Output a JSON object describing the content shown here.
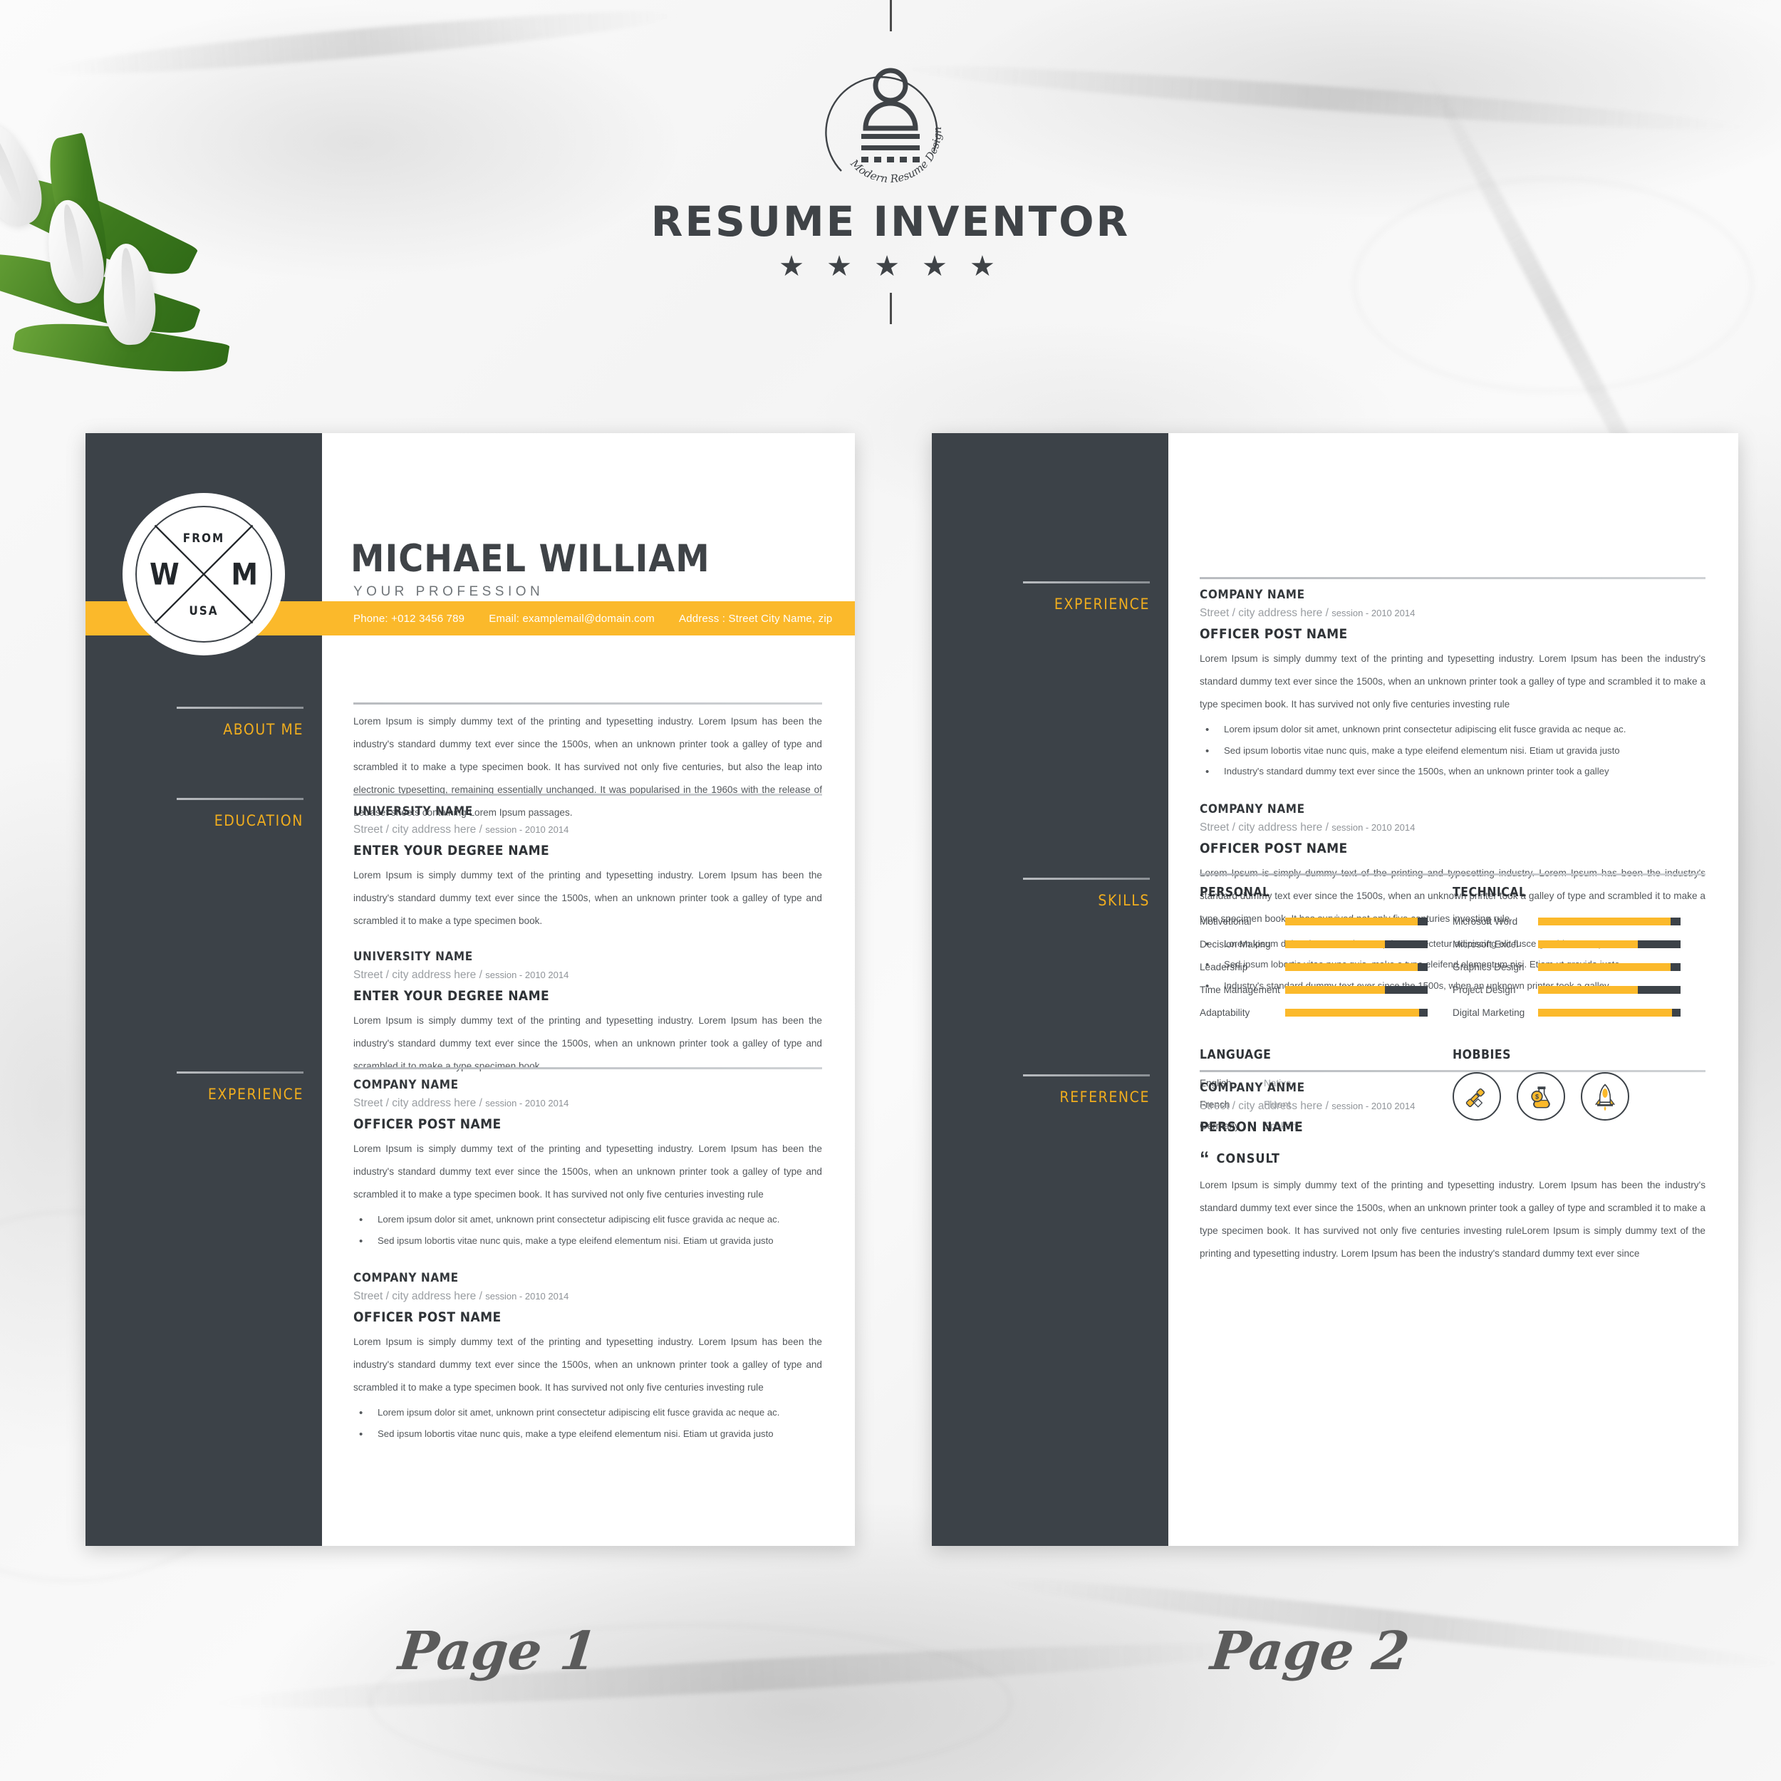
{
  "brand": {
    "title": "RESUME INVENTOR",
    "logo_caption": "Modern Resume Design",
    "stars": "★ ★ ★ ★ ★"
  },
  "page1": {
    "caption": "Page 1",
    "name": "MICHAEL WILLIAM",
    "profession": "YOUR PROFESSION",
    "monogram": {
      "top": "FROM",
      "left": "W",
      "right": "M",
      "bottom": "USA"
    },
    "contact": {
      "phone": "Phone: +012 3456 789",
      "email": "Email: examplemail@domain.com",
      "address": "Address : Street City Name, zip"
    },
    "rail": [
      {
        "label": "ABOUT ME"
      },
      {
        "label": "EDUCATION"
      },
      {
        "label": "EXPERIENCE"
      }
    ],
    "about": {
      "text": "Lorem Ipsum is simply dummy text of the printing and typesetting industry. Lorem Ipsum has been the industry's standard dummy text ever since the 1500s, when an unknown printer took a galley of type and scrambled it to make a type specimen book. It has survived not only five centuries, but also the leap into electronic typesetting, remaining essentially unchanged. It was popularised in the 1960s with the release of Letraset sheets containing Lorem Ipsum passages."
    },
    "education": [
      {
        "org": "UNIVERSITY NAME",
        "meta_main": "Street / city address here / ",
        "meta_sub": "session - 2010 2014",
        "role": "ENTER YOUR DEGREE NAME",
        "text": "Lorem Ipsum is simply dummy text of the printing and typesetting industry. Lorem Ipsum has been the industry's standard dummy text ever since the 1500s, when an unknown printer took a galley of type and scrambled it to make a type specimen book."
      },
      {
        "org": "UNIVERSITY NAME",
        "meta_main": "Street / city address here / ",
        "meta_sub": "session - 2010 2014",
        "role": "ENTER YOUR DEGREE NAME",
        "text": "Lorem Ipsum is simply dummy text of the printing and typesetting industry. Lorem Ipsum has been the industry's standard dummy text ever since the 1500s, when an unknown printer took a galley of type and scrambled it to make a type specimen book."
      }
    ],
    "experience": [
      {
        "org": "COMPANY NAME",
        "meta_main": "Street / city address here / ",
        "meta_sub": "session - 2010 2014",
        "role": "OFFICER POST NAME",
        "text": "Lorem Ipsum is simply dummy text of the printing and typesetting industry. Lorem Ipsum has been the industry's standard dummy text ever since the 1500s, when an unknown printer took a galley of type and scrambled it to make a type specimen book. It has survived not only five centuries investing rule",
        "bullets": [
          "Lorem ipsum dolor sit amet, unknown print consectetur adipiscing elit fusce gravida ac neque ac.",
          "Sed ipsum lobortis vitae nunc quis, make a type eleifend elementum nisi. Etiam ut gravida justo"
        ]
      },
      {
        "org": "COMPANY NAME",
        "meta_main": "Street / city address here / ",
        "meta_sub": "session - 2010 2014",
        "role": "OFFICER POST NAME",
        "text": "Lorem Ipsum is simply dummy text of the printing and typesetting industry. Lorem Ipsum has been the industry's standard dummy text ever since the 1500s, when an unknown printer took a galley of type and scrambled it to make a type specimen book. It has survived not only five centuries investing rule",
        "bullets": [
          "Lorem ipsum dolor sit amet, unknown print consectetur adipiscing elit fusce gravida ac neque ac.",
          "Sed ipsum lobortis vitae nunc quis, make a type eleifend elementum nisi. Etiam ut gravida justo"
        ]
      }
    ]
  },
  "page2": {
    "caption": "Page 2",
    "rail": [
      {
        "label": "EXPERIENCE"
      },
      {
        "label": "SKILLS"
      },
      {
        "label": "REFERENCE"
      }
    ],
    "experience": [
      {
        "org": "COMPANY NAME",
        "meta_main": "Street / city address here / ",
        "meta_sub": "session - 2010 2014",
        "role": "OFFICER POST NAME",
        "text": "Lorem Ipsum is simply dummy text of the printing and typesetting industry. Lorem Ipsum has been the industry's standard dummy text ever since the 1500s, when an unknown printer took a galley of type and scrambled it to make a type specimen book. It has survived not only five centuries investing rule",
        "bullets": [
          "Lorem ipsum dolor sit amet, unknown print consectetur adipiscing elit fusce gravida ac neque ac.",
          "Sed ipsum lobortis vitae nunc quis, make a type eleifend elementum nisi. Etiam ut gravida justo",
          "Industry's standard dummy text ever since the 1500s, when an unknown printer took a galley"
        ]
      },
      {
        "org": "COMPANY NAME",
        "meta_main": "Street / city address here / ",
        "meta_sub": "session - 2010 2014",
        "role": "OFFICER POST NAME",
        "text": "Lorem Ipsum is simply dummy text of the printing and typesetting industry. Lorem Ipsum has been the industry's standard dummy text ever since the 1500s, when an unknown printer took a galley of type and scrambled it to make a type specimen book. It has survived not only five centuries investing rule",
        "bullets": [
          "Lorem ipsum dolor sit amet, unknown print consectetur adipiscing elit fusce gravida ac neque ac.",
          "Sed ipsum lobortis vitae nunc quis, make a type eleifend elementum nisi. Etiam ut gravida justo",
          "Industry's standard dummy text ever since the 1500s, when an unknown printer took a galley"
        ]
      }
    ],
    "skills": {
      "personal_heading": "PERSONAL",
      "technical_heading": "TECHNICAL",
      "personal": [
        {
          "name": "Motivetional",
          "value": 93
        },
        {
          "name": "Decision Making",
          "value": 70
        },
        {
          "name": "Leadership",
          "value": 93
        },
        {
          "name": "Time Management",
          "value": 70
        },
        {
          "name": "Adaptability",
          "value": 94
        }
      ],
      "technical": [
        {
          "name": "Microsoft Word",
          "value": 93
        },
        {
          "name": "Microsoft Excel",
          "value": 70
        },
        {
          "name": "Graphics Design",
          "value": 93
        },
        {
          "name": "Project Design",
          "value": 70
        },
        {
          "name": "Digital Marketing",
          "value": 94
        }
      ]
    },
    "language": {
      "heading": "LANGUAGE",
      "items": [
        {
          "name": "English",
          "level": "Native"
        },
        {
          "name": "French",
          "level": "Fluent"
        },
        {
          "name": "Germany",
          "level": "Spoken"
        }
      ]
    },
    "hobbies": {
      "heading": "HOBBIES",
      "icons": [
        "thumbs-up-icon",
        "money-flask-icon",
        "rocket-icon"
      ]
    },
    "reference": {
      "org": "COMPANY ANME",
      "meta_main": "Street / city address here / ",
      "meta_sub": "session - 2010 2014",
      "person": "PERSON NAME",
      "quote_label": "CONSULT",
      "text": "Lorem Ipsum is simply dummy text of the printing and typesetting industry. Lorem Ipsum has been the industry's standard dummy text ever since the 1500s, when an unknown printer took a galley of type and scrambled it to make a type specimen book. It has survived not only five centuries investing ruleLorem Ipsum is simply dummy text of the printing and typesetting industry. Lorem Ipsum has been the industry's standard dummy text ever since"
    }
  },
  "colors": {
    "accent": "#fbb92b",
    "dark": "#3c4248",
    "text": "#54585c",
    "muted": "#9a9ea2"
  }
}
